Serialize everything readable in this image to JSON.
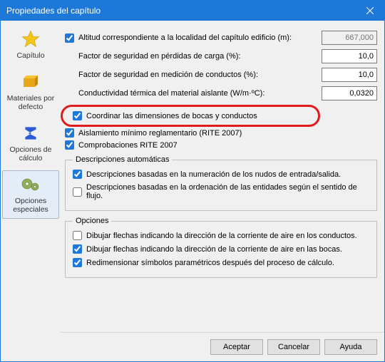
{
  "window": {
    "title": "Propiedades del capítulo"
  },
  "sidebar": {
    "items": [
      {
        "label": "Capítulo"
      },
      {
        "label": "Materiales por defecto"
      },
      {
        "label": "Opciones de cálculo"
      },
      {
        "label": "Opciones especiales"
      }
    ]
  },
  "fields": {
    "altitud_label": "Altitud correspondiente a la localidad del capítulo edificio (m):",
    "altitud_value": "667,000",
    "fseg_carga_label": "Factor de seguridad en pérdidas de carga (%):",
    "fseg_carga_value": "10,0",
    "fseg_med_label": "Factor de seguridad en medición de conductos (%):",
    "fseg_med_value": "10,0",
    "cond_label": "Conductividad térmica del material aislante (W/m·ºC):",
    "cond_value": "0,0320",
    "coord_label": "Coordinar las dimensiones de bocas y conductos",
    "aisl_label": "Aislamiento mínimo reglamentario (RITE 2007)",
    "comp_label": "Comprobaciones RITE 2007"
  },
  "desc_auto": {
    "legend": "Descripciones automáticas",
    "num_label": "Descripciones basadas en la numeración de los nudos de entrada/salida.",
    "ord_label": "Descripciones basadas en la ordenación de las entidades según el sentido de flujo."
  },
  "opciones": {
    "legend": "Opciones",
    "flechas_cond": "Dibujar flechas indicando la dirección de la corriente de aire en los conductos.",
    "flechas_bocas": "Dibujar flechas indicando la dirección de la corriente de aire en las bocas.",
    "redim": "Redimensionar símbolos paramétricos después del proceso de cálculo."
  },
  "buttons": {
    "ok": "Aceptar",
    "cancel": "Cancelar",
    "help": "Ayuda"
  }
}
